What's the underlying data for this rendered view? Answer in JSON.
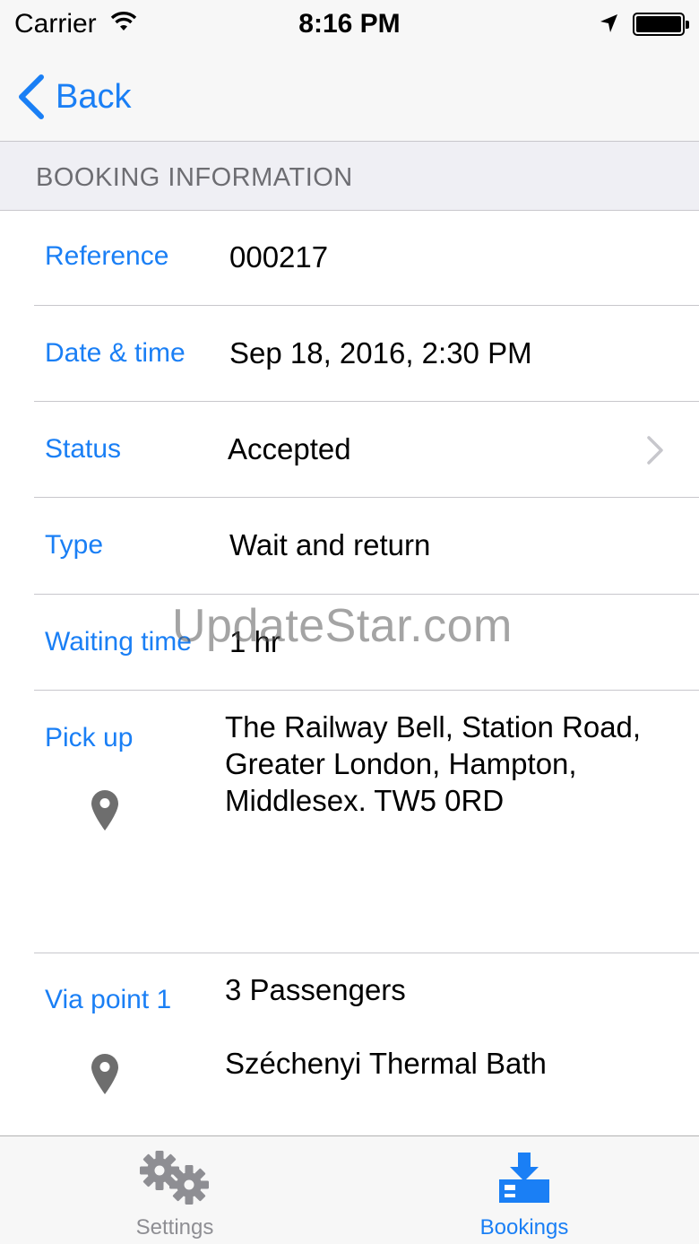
{
  "status_bar": {
    "carrier": "Carrier",
    "time": "8:16 PM",
    "battery_level": 1.0
  },
  "nav": {
    "back_label": "Back"
  },
  "section": {
    "title": "BOOKING INFORMATION"
  },
  "rows": [
    {
      "label": "Reference",
      "value": "000217"
    },
    {
      "label": "Date & time",
      "value": "Sep 18, 2016, 2:30 PM"
    },
    {
      "label": "Status",
      "value": "Accepted"
    },
    {
      "label": "Type",
      "value": "Wait and return"
    },
    {
      "label": "Waiting time",
      "value": "1 hr"
    },
    {
      "label": "Pick up",
      "lines": [
        "The Railway Bell, Station Road,",
        "Greater London, Hampton,",
        "Middlesex. TW5 0RD"
      ]
    },
    {
      "label": "Via point 1",
      "passengers": "3 Passengers",
      "place": "Széchenyi Thermal Bath"
    }
  ],
  "watermark": "UpdateStar.com",
  "tabs": [
    {
      "label": "Settings",
      "icon": "gear-icon",
      "selected": false
    },
    {
      "label": "Bookings",
      "icon": "download-tray-icon",
      "selected": true
    }
  ],
  "colors": {
    "accent": "#1a7ff5",
    "label_gray": "#6d6d72",
    "tab_inactive": "#8e8e93",
    "pin_gray": "#6e6e6e"
  }
}
